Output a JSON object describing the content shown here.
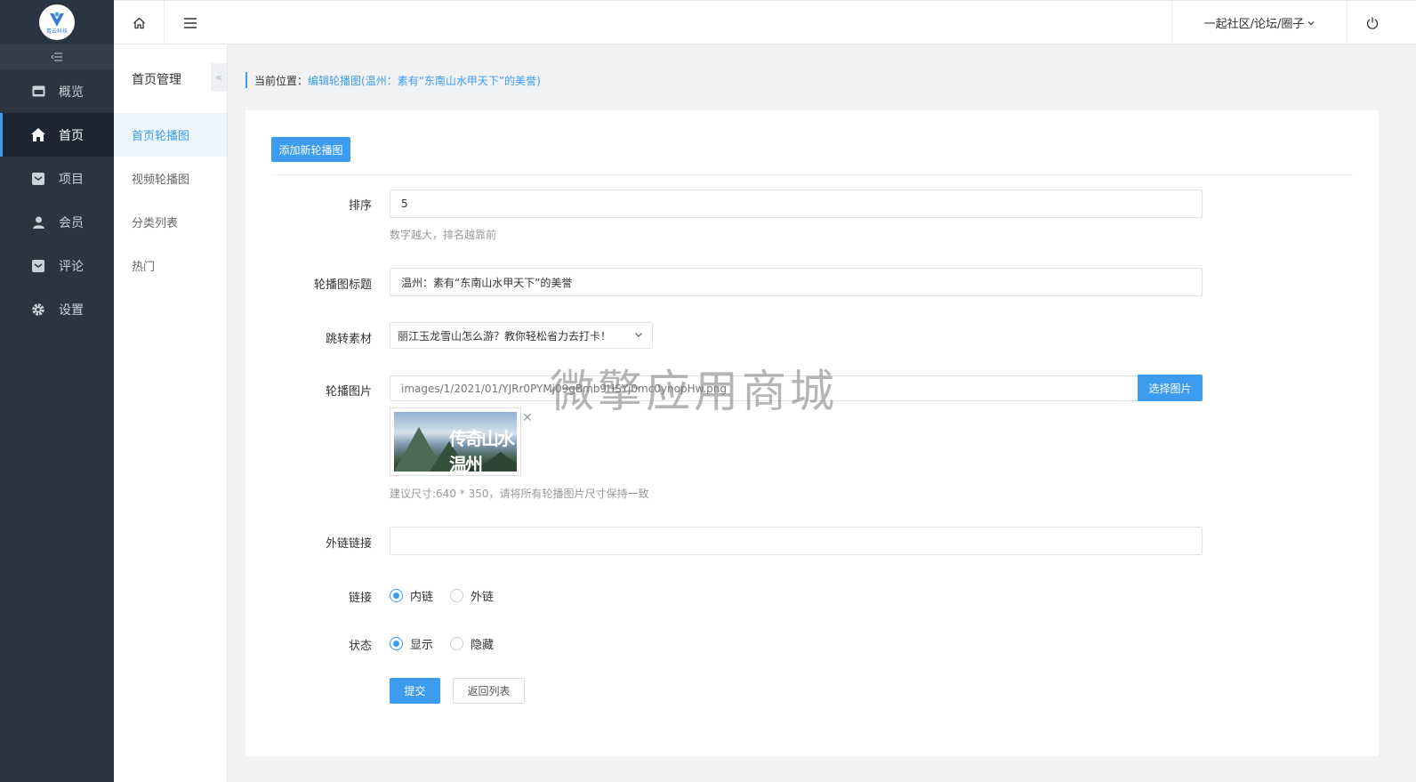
{
  "logo": {
    "text": "青云科技"
  },
  "sidebar": {
    "items": [
      {
        "label": "概览",
        "icon": "dashboard-icon"
      },
      {
        "label": "首页",
        "icon": "home-icon",
        "active": true
      },
      {
        "label": "项目",
        "icon": "project-icon"
      },
      {
        "label": "会员",
        "icon": "user-icon"
      },
      {
        "label": "评论",
        "icon": "comment-icon"
      },
      {
        "label": "设置",
        "icon": "gear-icon"
      }
    ]
  },
  "subnav": {
    "title": "首页管理",
    "collapse_glyph": "«",
    "items": [
      {
        "label": "首页轮播图",
        "active": true
      },
      {
        "label": "视频轮播图"
      },
      {
        "label": "分类列表"
      },
      {
        "label": "热门"
      }
    ]
  },
  "header": {
    "community_label": "一起社区/论坛/圈子"
  },
  "breadcrumb": {
    "label": "当前位置：",
    "value": "编辑轮播图(温州：素有“东南山水甲天下”的美誉)"
  },
  "form": {
    "add_button": "添加新轮播图",
    "sort": {
      "label": "排序",
      "value": "5",
      "help": "数字越大，排名越靠前"
    },
    "title": {
      "label": "轮播图标题",
      "value": "温州：素有“东南山水甲天下”的美誉"
    },
    "jump": {
      "label": "跳转素材",
      "selected": "丽江玉龙雪山怎么游？教你轻松省力去打卡！"
    },
    "image": {
      "label": "轮播图片",
      "path": "images/1/2021/01/YJRr0PYMj09gBmb9HSYj0mc0ynopHw.png",
      "choose_button": "选择图片",
      "preview_text": "传奇山水温州",
      "remove_glyph": "✕",
      "help": "建议尺寸:640 * 350，请将所有轮播图片尺寸保持一致"
    },
    "external_link": {
      "label": "外链链接",
      "value": ""
    },
    "link": {
      "label": "链接",
      "options": [
        "内链",
        "外链"
      ],
      "selected": "内链"
    },
    "status": {
      "label": "状态",
      "options": [
        "显示",
        "隐藏"
      ],
      "selected": "显示"
    },
    "submit_button": "提交",
    "back_button": "返回列表"
  },
  "watermark": "微擎应用商城",
  "colors": {
    "sidebar_bg": "#2b3542",
    "accent": "#3b9cf0",
    "page_bg": "#f1f2f4"
  }
}
